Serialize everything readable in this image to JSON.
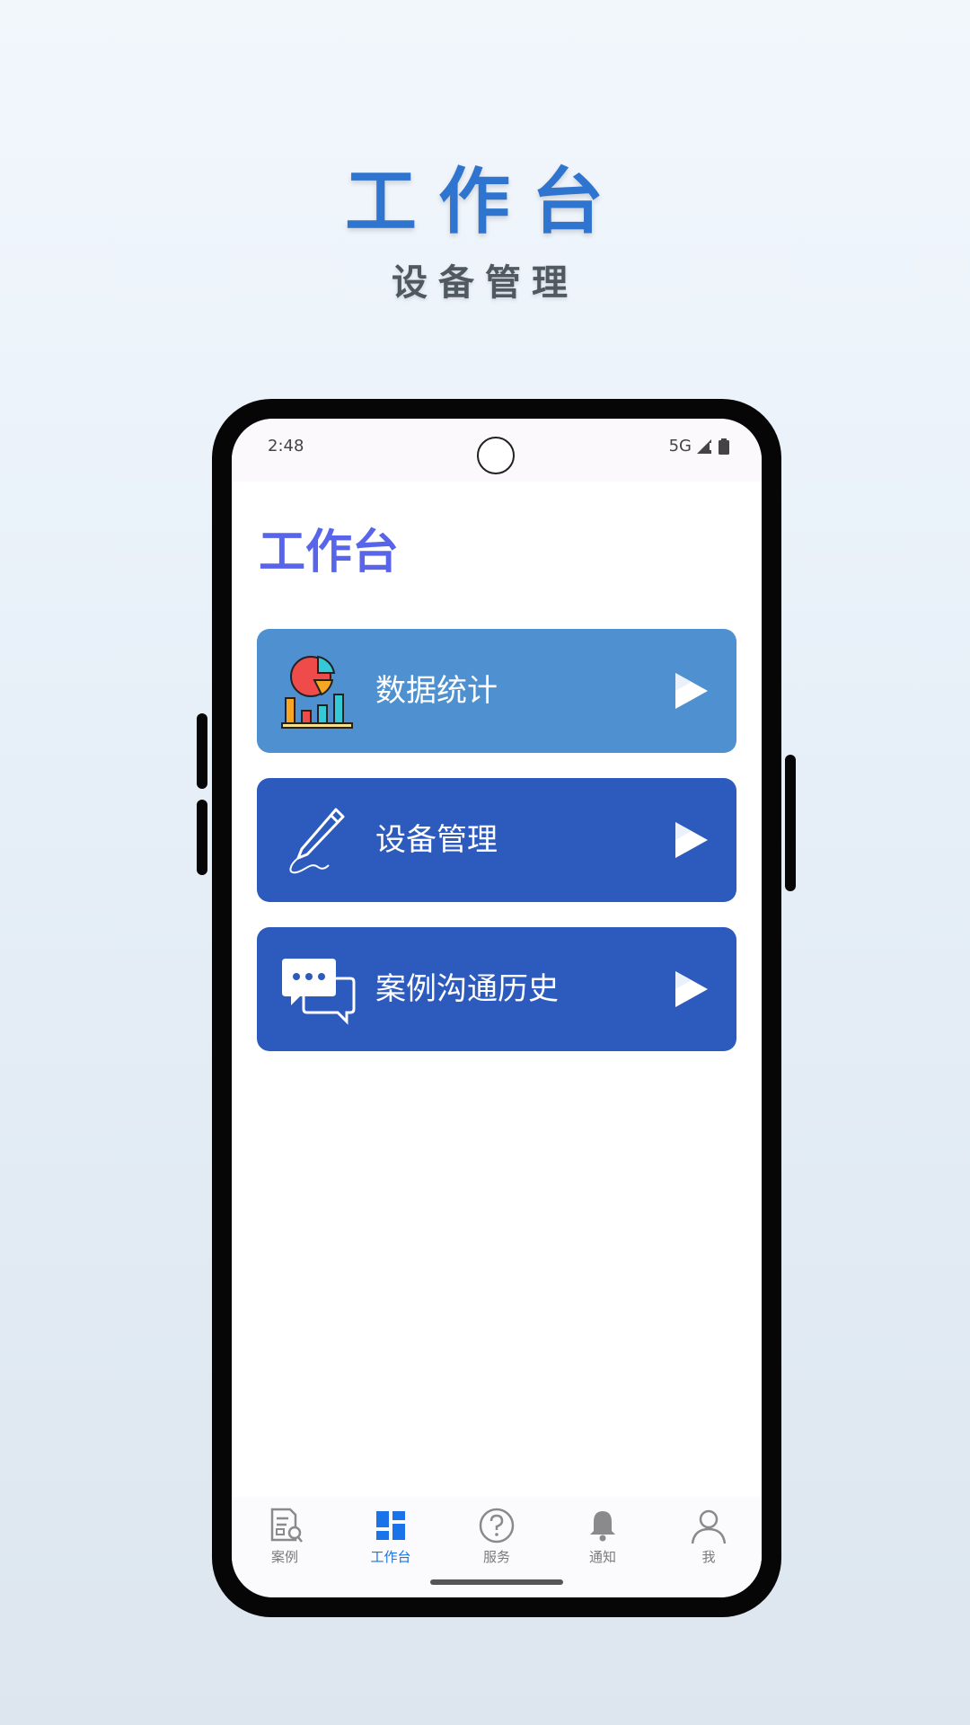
{
  "promo": {
    "title": "工作台",
    "subtitle": "设备管理"
  },
  "status_bar": {
    "time": "2:48",
    "network": "5G"
  },
  "app": {
    "title": "工作台"
  },
  "menu": [
    {
      "label": "数据统计",
      "icon": "chart-icon",
      "color": "#4f91d0"
    },
    {
      "label": "设备管理",
      "icon": "pen-icon",
      "color": "#2d5abd"
    },
    {
      "label": "案例沟通历史",
      "icon": "chat-icon",
      "color": "#2d5abd"
    }
  ],
  "bottom_nav": {
    "active_color": "#1a73e8",
    "inactive_color": "#7a7a7a",
    "items": [
      {
        "label": "案例",
        "icon": "case-icon",
        "active": false
      },
      {
        "label": "工作台",
        "icon": "dashboard-icon",
        "active": true
      },
      {
        "label": "服务",
        "icon": "help-icon",
        "active": false
      },
      {
        "label": "通知",
        "icon": "bell-icon",
        "active": false
      },
      {
        "label": "我",
        "icon": "user-icon",
        "active": false
      }
    ]
  },
  "colors": {
    "accent_title": "#2f74cf",
    "app_title": "#5865ea"
  }
}
